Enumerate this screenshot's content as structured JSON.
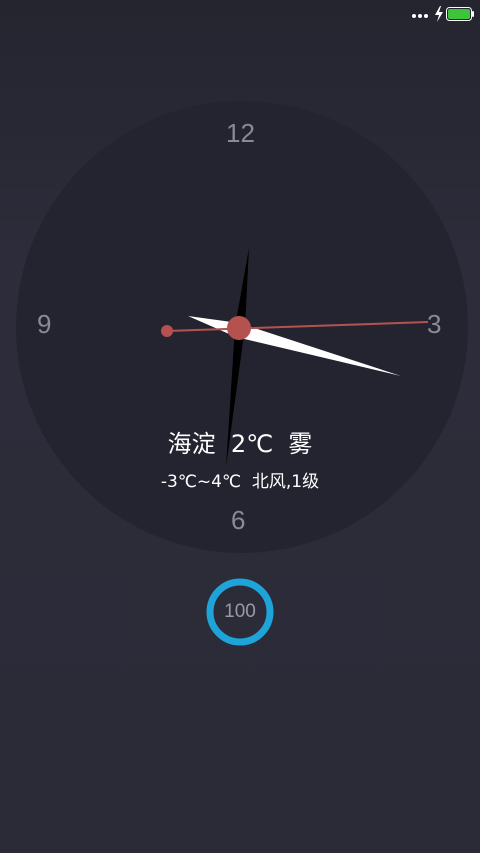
{
  "status_bar": {
    "icons": [
      "more-dots-icon",
      "charging-bolt-icon",
      "battery-icon"
    ],
    "battery_color": "#3ec43a"
  },
  "clock": {
    "numerals": {
      "twelve": "12",
      "three": "3",
      "six": "6",
      "nine": "9"
    },
    "face_color": "#242431",
    "hand_color_hour": "#000000",
    "hand_color_minute": "#ffffff",
    "hand_color_second": "#b5524f"
  },
  "weather": {
    "location_temp_condition": "海淀  2℃  雾",
    "range_wind": "-3℃~4℃  北风,1级"
  },
  "score": {
    "value": "100",
    "ring_color": "#1ea4d8"
  }
}
